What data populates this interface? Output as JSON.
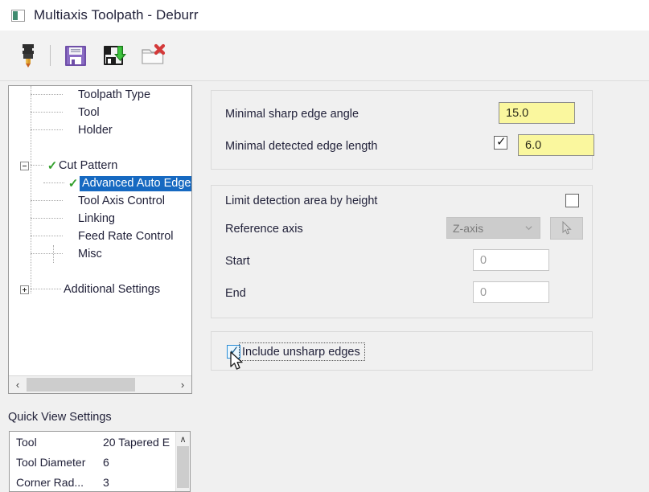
{
  "window": {
    "title": "Multiaxis Toolpath - Deburr",
    "icon": "window-app-icon"
  },
  "toolbar": {
    "buttons": [
      {
        "name": "tool-button",
        "icon": "endmill-tool-icon",
        "label": "Tool"
      },
      {
        "name": "save-button",
        "icon": "floppy-disk-save-icon",
        "label": "Save"
      },
      {
        "name": "save-and-load-button",
        "icon": "floppy-disk-green-arrow-icon",
        "label": "Save and Load"
      },
      {
        "name": "delete-button",
        "icon": "folder-red-x-icon",
        "label": "Delete"
      }
    ]
  },
  "tree": {
    "items": [
      {
        "label": "Toolpath Type",
        "level": 1,
        "expander": "none",
        "check": false,
        "selected": false
      },
      {
        "label": "Tool",
        "level": 1,
        "expander": "none",
        "check": false,
        "selected": false
      },
      {
        "label": "Holder",
        "level": 1,
        "expander": "none",
        "check": false,
        "selected": false
      },
      {
        "label": "Cut Pattern",
        "level": 1,
        "expander": "minus",
        "check": true,
        "selected": false
      },
      {
        "label": "Advanced Auto Edge",
        "level": 2,
        "expander": "none",
        "check": true,
        "selected": true
      },
      {
        "label": "Tool Axis Control",
        "level": 1,
        "expander": "none",
        "check": false,
        "selected": false
      },
      {
        "label": "Linking",
        "level": 1,
        "expander": "none",
        "check": false,
        "selected": false
      },
      {
        "label": "Feed Rate Control",
        "level": 1,
        "expander": "none",
        "check": false,
        "selected": false
      },
      {
        "label": "Misc",
        "level": 1,
        "expander": "none",
        "check": false,
        "selected": false
      },
      {
        "label": "Additional Settings",
        "level": 1,
        "expander": "plus",
        "check": false,
        "selected": false
      }
    ],
    "scroll": {
      "left_arrow": "‹",
      "right_arrow": "›"
    }
  },
  "quick_view": {
    "title": "Quick View Settings",
    "rows": [
      {
        "key": "Tool",
        "value": "20 Tapered E"
      },
      {
        "key": "Tool Diameter",
        "value": "6"
      },
      {
        "key": "Corner Rad...",
        "value": "3"
      }
    ],
    "scroll_up_arrow": "∧"
  },
  "settings": {
    "edge_group": {
      "min_sharp_edge_angle": {
        "label": "Minimal sharp edge angle",
        "value": "15.0"
      },
      "min_detected_edge_length": {
        "label": "Minimal detected edge length",
        "value": "6.0",
        "checked": true
      }
    },
    "limit_group": {
      "limit_by_height": {
        "label": "Limit detection area by height",
        "checked": false
      },
      "reference_axis": {
        "label": "Reference axis",
        "value": "Z-axis",
        "enabled": false
      },
      "pick_button": {
        "icon": "cursor-pick-icon",
        "enabled": false
      },
      "start": {
        "label": "Start",
        "value": "0",
        "enabled": false
      },
      "end": {
        "label": "End",
        "value": "0",
        "enabled": false
      }
    },
    "unsharp_group": {
      "include_unsharp_edges": {
        "label": "Include unsharp edges",
        "checked": true,
        "focused": true,
        "hovered": true
      }
    }
  },
  "colors": {
    "highlight_blue": "#1669c1",
    "input_yellow": "#faf79e",
    "check_green": "#33a02c",
    "window_bg": "#f0f0f0",
    "hover_blue": "#2a8cd6"
  }
}
